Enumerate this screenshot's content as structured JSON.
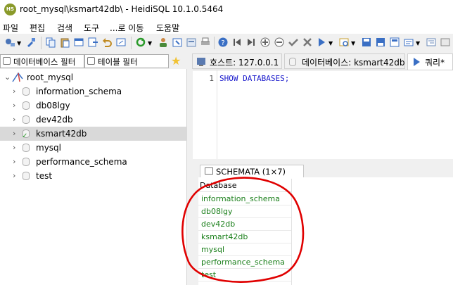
{
  "window": {
    "title": "root_mysql\\ksmart42db\\ - HeidiSQL 10.1.0.5464",
    "icon_text": "HS"
  },
  "menu": [
    "파일",
    "편집",
    "검색",
    "도구",
    "...로 이동",
    "도움말"
  ],
  "filters": {
    "database_filter": "데이터베이스 필터",
    "table_filter": "테이블 필터"
  },
  "tree": {
    "root": "root_mysql",
    "items": [
      {
        "label": "information_schema",
        "selected": false
      },
      {
        "label": "db08lgy",
        "selected": false
      },
      {
        "label": "dev42db",
        "selected": false
      },
      {
        "label": "ksmart42db",
        "selected": true
      },
      {
        "label": "mysql",
        "selected": false
      },
      {
        "label": "performance_schema",
        "selected": false
      },
      {
        "label": "test",
        "selected": false
      }
    ]
  },
  "tabs": [
    {
      "label": "호스트: 127.0.0.1",
      "icon": "host-icon"
    },
    {
      "label": "데이터베이스: ksmart42db",
      "icon": "database-icon"
    },
    {
      "label": "쿼리*",
      "icon": "play-icon"
    }
  ],
  "editor": {
    "line_number": "1",
    "code": "SHOW DATABASES;"
  },
  "result": {
    "tab_label": "SCHEMATA (1×7)",
    "column": "Database",
    "rows": [
      "information_schema",
      "db08lgy",
      "dev42db",
      "ksmart42db",
      "mysql",
      "performance_schema",
      "test"
    ]
  },
  "colors": {
    "selection": "#d9d9d9",
    "keyword": "#1a1acc",
    "result_text": "#1a7f1a",
    "annotation": "#e00000"
  }
}
